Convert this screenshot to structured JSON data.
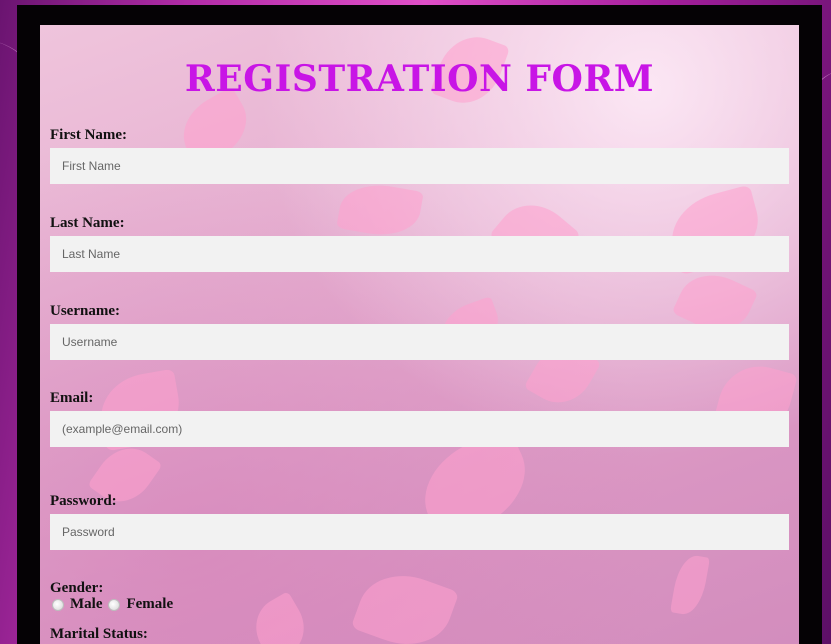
{
  "form": {
    "title": "REGISTRATION FORM",
    "fields": [
      {
        "label": "First Name:",
        "placeholder": "First Name",
        "value": ""
      },
      {
        "label": "Last Name:",
        "placeholder": "Last Name",
        "value": ""
      },
      {
        "label": "Username:",
        "placeholder": "Username",
        "value": ""
      },
      {
        "label": "Email:",
        "placeholder": "(example@email.com)",
        "value": ""
      },
      {
        "label": "Password:",
        "placeholder": "Password",
        "value": ""
      }
    ],
    "gender": {
      "label": "Gender:",
      "options": [
        "Male",
        "Female"
      ],
      "selected": ""
    },
    "marital_status": {
      "label": "Marital Status:"
    }
  },
  "colors": {
    "title": "#c815e6",
    "frame": "#050205",
    "input_background": "#f2f2f2",
    "page_background": "#b22ca8"
  },
  "icons": {
    "radio": "radio-circle-icon"
  }
}
